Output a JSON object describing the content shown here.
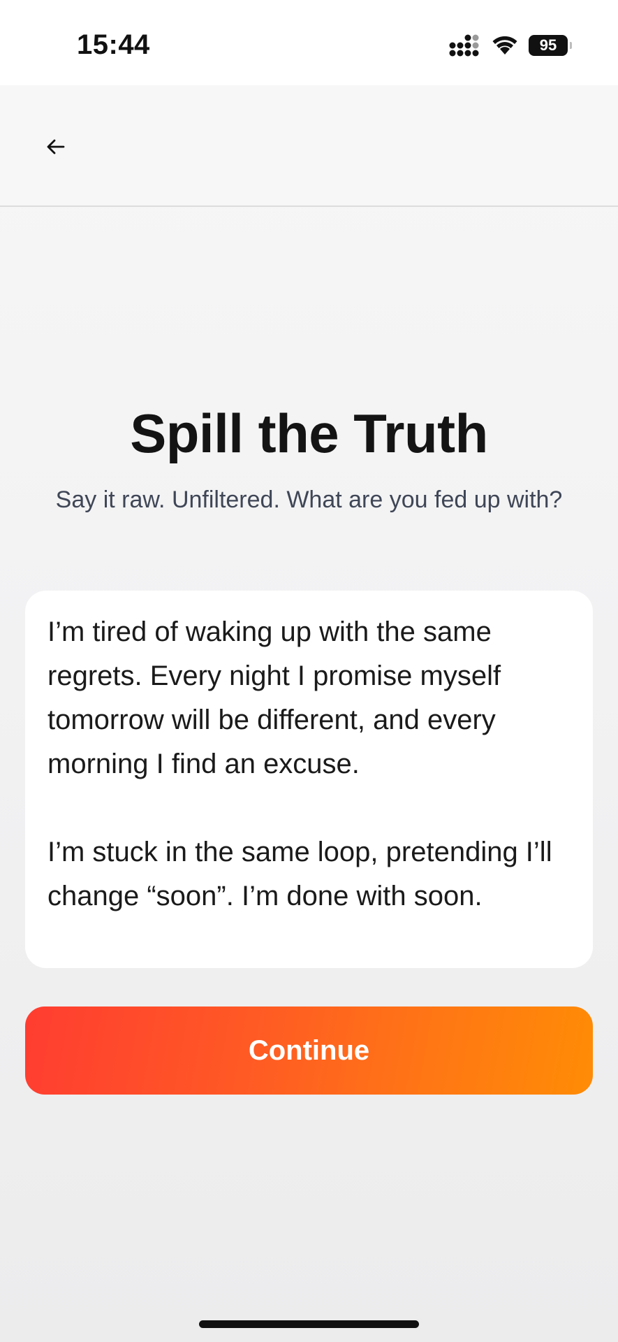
{
  "status_bar": {
    "time": "15:44",
    "battery": "95"
  },
  "nav": {
    "back_icon": "arrow-left-icon"
  },
  "content": {
    "title": "Spill the Truth",
    "subtitle": "Say it raw. Unfiltered. What are you fed up with?",
    "entry_text": "I’m tired of waking up with the same regrets. Every night I promise myself tomorrow will be different, and every morning I find an excuse.\n\nI’m stuck in the same loop, pretending I’ll change “soon”. I’m done with soon."
  },
  "continue_button": {
    "label": "Continue"
  },
  "colors": {
    "accent_start": "#ff3d31",
    "accent_end": "#ff8c05",
    "title": "#141414",
    "subtitle": "#3f4656"
  }
}
